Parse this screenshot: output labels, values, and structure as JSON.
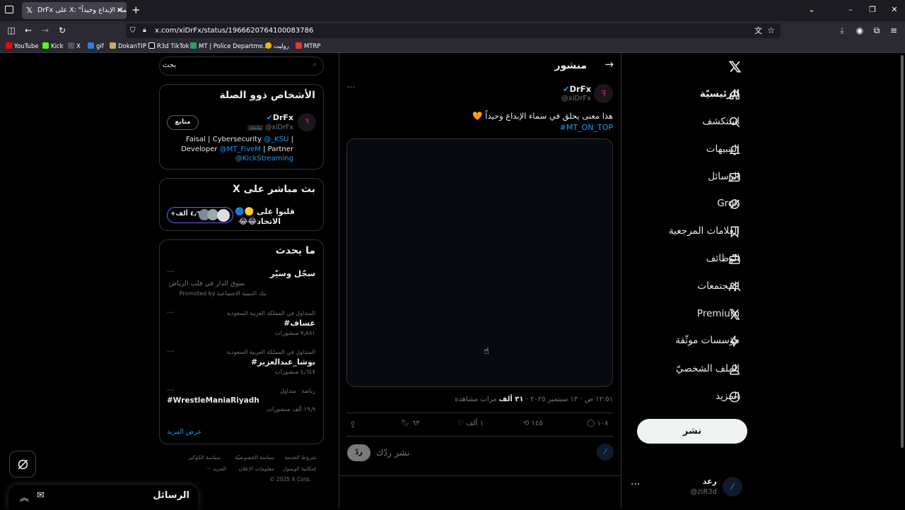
{
  "browser": {
    "tab_title": "DrFx على X: \"هذا معنى يحلق في سماء الإبداع وحيداً",
    "url": "x.com/xiDrFx/status/1966620764100083786",
    "bookmarks": [
      "YouTube",
      "Kick",
      "X",
      "gif",
      "DokanTIP",
      "R3d TikTok",
      "MT | Police Departme...",
      "روليت",
      "MTRP"
    ]
  },
  "nav": {
    "items": [
      "الرئيسيّة",
      "استكشف",
      "التنبيهات",
      "الرسائل",
      "Grok",
      "العلامات المرجعية",
      "الوظائف",
      "المجتمعات",
      "Premium",
      "مؤسسات موثّقة",
      "الملف الشخصيّ",
      "المزيد"
    ],
    "post_button": "نشر",
    "account_name": "رعد",
    "account_handle": "@ziR3d"
  },
  "post": {
    "header_title": "منشور",
    "author_name": "DrFx",
    "author_handle": "@xiDrFx",
    "text_line1": "هذا معنى يحلق في سماء الإبداع وحيداً 🧡",
    "hashtag": "#MT_ON_TOP",
    "meta_time": "١٢:٥١ ص · ١٣ سبتمبر ٢٠٢٥ · ",
    "meta_views": "٣١ ألف",
    "meta_views_label": " مرات مشاهدة",
    "replies": "١٠٨",
    "reposts": "١٤٥",
    "likes": "١ ألف",
    "bookmarks": "٦٣",
    "reply_placeholder": "نشر ردّك",
    "reply_button": "ردّ"
  },
  "sidebar": {
    "search_placeholder": "بحث",
    "relevant_title": "الأشخاص ذوو الصلة",
    "follow_button": "متابع",
    "person_name": "DrFx",
    "person_handle": "@xiDrFx",
    "follows_you": "يتابعك",
    "bio_line1_a": "Faisal | Cybersecurity ",
    "bio_line1_link": "@_KSU",
    "bio_line1_b": " |",
    "bio_line2_a": "Developer ",
    "bio_line2_link": "@MT_FiveM",
    "bio_line2_b": " | Partner",
    "bio_line3_link": "@KickStreaming",
    "live_title": "بث مباشر على X",
    "live_text1": "قلبوا على 🟡🔵",
    "live_text2": "الاتحاد😂😂",
    "live_count": "+٤٫٦ ألف",
    "trends_title": "ما يحدث",
    "promo_title": "سجّل وسيّر",
    "promo_sub": "سوق الدار في قلب الرياض",
    "promo_by": "Promoted by بنك التنمية الاجتماعية",
    "trends": [
      {
        "context": "المتداول في المملكة العربية السعودية",
        "name": "#عساف",
        "count": "٧٫٨٨١ منشورات"
      },
      {
        "context": "المتداول في المملكة العربية السعودية",
        "name": "#بوشا_عبدالعزيز",
        "count": "٤٫٦٤٧ منشورات"
      },
      {
        "context": "رياضة · متداول",
        "name": "#WrestleManiaRiyadh",
        "count": "١٩٫٩ ألف منشورات"
      }
    ],
    "show_more": "عرض المزيد",
    "footer_row1": [
      "شروط الخدمة",
      "سياسة الخصوصيّة",
      "سياسة الكوكيز"
    ],
    "footer_row2": [
      "إمكانية الوصول",
      "معلومات الإعلان",
      "··· المزيد"
    ],
    "copyright": "© 2025 X Corp."
  },
  "messages_dock": {
    "title": "الرسائل"
  },
  "colors": {
    "accent": "#1d9bf0",
    "border": "#2f3336",
    "muted": "#71767b",
    "bg": "#000000"
  }
}
